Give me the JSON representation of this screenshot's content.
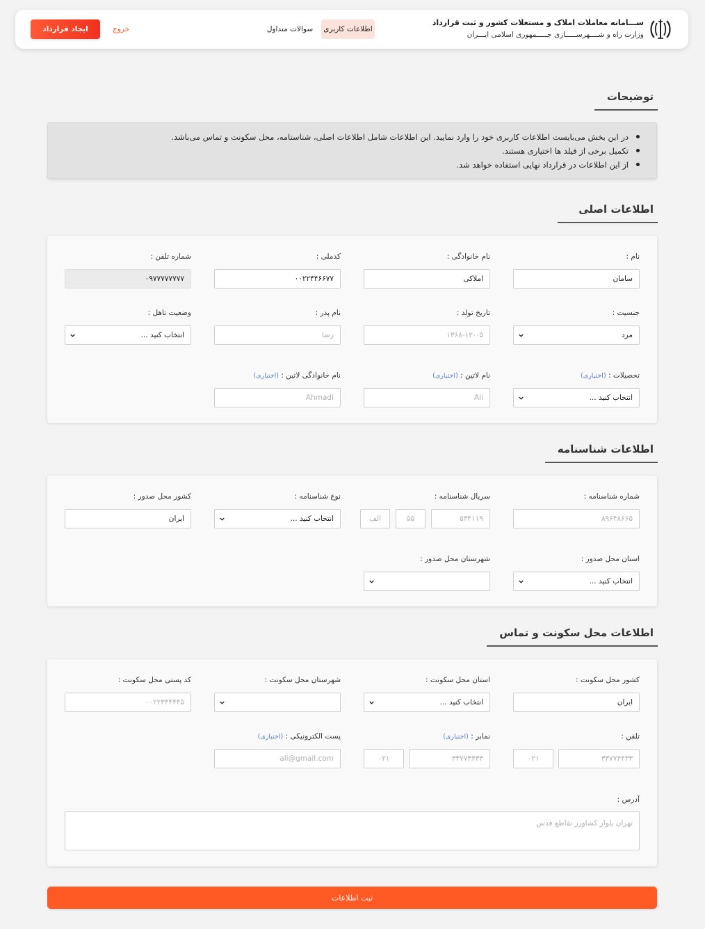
{
  "header": {
    "title": "ســـامانه معاملات املاک و مستغلات کشور و ثبت قرارداد",
    "subtitle": "وزارت راه و شــــهرســـــازی جـــــمهوری اسلامی ایـــران",
    "nav_user_info": "اطلاعات کاربری",
    "nav_faq": "سوالات متداول",
    "nav_exit": "خروج",
    "create_contract": "ایجاد قرارداد"
  },
  "description": {
    "title": "توضیحات",
    "items": [
      "در این بخش می‌بایست اطلاعات کاربری خود را وارد نمایید. این اطلاعات شامل اطلاعات اصلی، شناسنامه، محل سکونت و تماس می‌باشد.",
      "تکمیل برخی از فیلد ها اختیاری هستند.",
      "از این اطلاعات در قرارداد نهایی استفاده خواهد شد."
    ]
  },
  "optional_tag": "(اختیاری)",
  "main_info": {
    "title": "اطلاعات اصلی",
    "first_name": {
      "label": "نام :",
      "value": "سامان"
    },
    "last_name": {
      "label": "نام خانوادگی :",
      "value": "املاکی"
    },
    "national_code": {
      "label": "کدملی :",
      "value": "۰۰۲۲۴۴۶۶۷۷"
    },
    "phone": {
      "label": "شماره تلفن :",
      "value": "۰۹۷۷۷۷۷۷۷۷"
    },
    "gender": {
      "label": "جنسیت :",
      "value": "مرد"
    },
    "birth_date": {
      "label": "تاریخ تولد :",
      "placeholder": "۱۳۶۸-۱۲-۰۵"
    },
    "father_name": {
      "label": "نام پدر :",
      "placeholder": "رضا"
    },
    "marital_status": {
      "label": "وضعیت تاهل :",
      "value": "انتخاب کنید ..."
    },
    "education": {
      "label": "تحصیلات :",
      "value": "انتخاب کنید ..."
    },
    "latin_name": {
      "label": "نام لاتین :",
      "placeholder": "Ali"
    },
    "latin_last_name": {
      "label": "نام خانوادگی لاتین :",
      "placeholder": "Ahmadi"
    }
  },
  "birth_cert": {
    "title": "اطلاعات شناسنامه",
    "number": {
      "label": "شماره شناسنامه :",
      "placeholder": "۸۹۶۴۸۶۶۵"
    },
    "serial": {
      "label": "سریال شناسنامه :",
      "placeholder_main": "۵۳۴۱۱۹",
      "placeholder_mid": "۵۵",
      "placeholder_letter": "الف"
    },
    "type": {
      "label": "نوع شناسنامه :",
      "value": "انتخاب کنید ..."
    },
    "issue_country": {
      "label": "کشور محل صدور :",
      "value": "ایران"
    },
    "issue_province": {
      "label": "استان محل صدور :",
      "value": "انتخاب کنید ..."
    },
    "issue_city": {
      "label": "شهرستان محل صدور :",
      "value": ""
    }
  },
  "residence": {
    "title": "اطلاعات محل سکونت و تماس",
    "country": {
      "label": "کشور محل سکونت :",
      "value": "ایران"
    },
    "province": {
      "label": "استان محل سکونت :",
      "value": "انتخاب کنید ..."
    },
    "city": {
      "label": "شهرستان محل سکونت :",
      "value": ""
    },
    "postal_code": {
      "label": "کد پستی محل سکونت :",
      "placeholder": "۰۰۲۲۳۳۴۴۴۵"
    },
    "phone": {
      "label": "تلفن :",
      "placeholder_number": "۳۳۷۷۴۴۳۳",
      "placeholder_code": "۰۲۱"
    },
    "fax": {
      "label": "نمابر :",
      "placeholder_number": "۳۳۷۷۴۴۳۳",
      "placeholder_code": "۰۲۱"
    },
    "email": {
      "label": "پست الکترونیکی :",
      "placeholder": "ali@gmail.com"
    },
    "address": {
      "label": "آدرس :",
      "placeholder": "تهران بلوار کشاورز تقاطع قدس"
    }
  },
  "submit_label": "ثبت اطلاعات",
  "colors": {
    "accent": "#ff5a24",
    "nav_active_bg": "#fbe3dc",
    "optional": "#5b7fc4"
  }
}
